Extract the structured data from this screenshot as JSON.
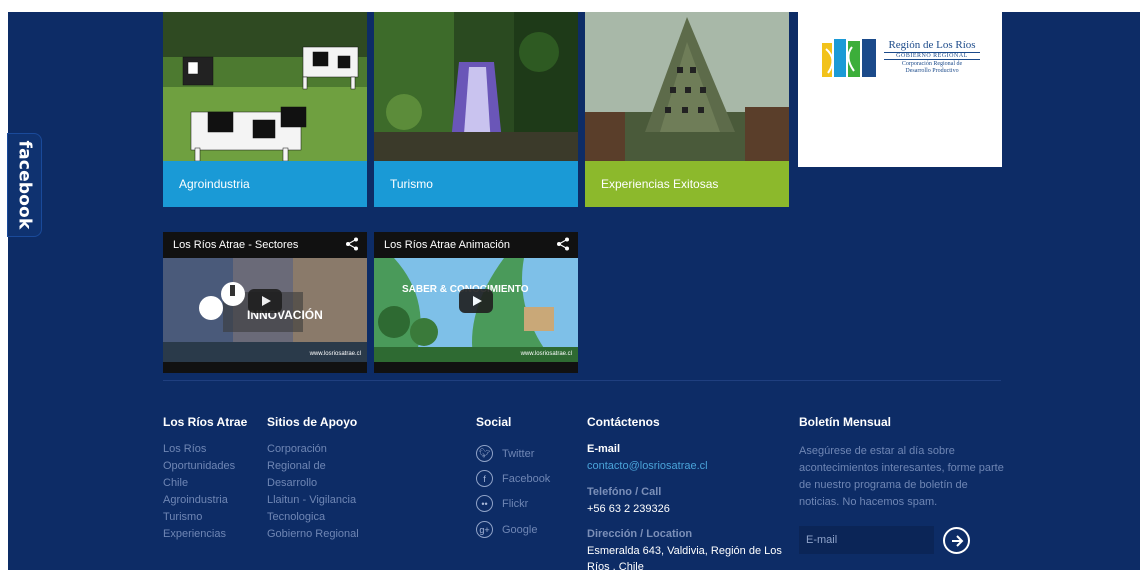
{
  "sidebar_tab": {
    "label": "facebook"
  },
  "tiles": [
    {
      "label": "Agroindustria",
      "color": "#1a9ad6"
    },
    {
      "label": "Turismo",
      "color": "#1a9ad6"
    },
    {
      "label": "Experiencias Exitosas",
      "color": "#8cb92c"
    }
  ],
  "logo": {
    "line1": "Región de Los Ríos",
    "line2": "GOBIERNO REGIONAL",
    "line3": "Corporación Regional de",
    "line4": "Desarrollo Productivo"
  },
  "videos": [
    {
      "title": "Los Ríos Atrae - Sectores",
      "overlay": "INNOVACIÓN",
      "url": "www.losriosatrae.cl"
    },
    {
      "title": "Los Ríos Atrae Animación",
      "overlay": "SABER & CONOCIMIENTO",
      "url": "www.losriosatrae.cl"
    }
  ],
  "footer": {
    "col1": {
      "heading": "Los Ríos Atrae",
      "items": [
        "Los Ríos",
        "Oportunidades",
        "Chile",
        "Agroindustria",
        "Turismo",
        "Experiencias"
      ]
    },
    "col2": {
      "heading": "Sitios de Apoyo",
      "items": [
        "Corporación",
        "Regional de",
        "Desarrollo",
        "Llaitun - Vigilancia",
        "Tecnologica",
        "Gobierno Regional"
      ]
    },
    "social": {
      "heading": "Social",
      "items": [
        "Twitter",
        "Facebook",
        "Flickr",
        "Google"
      ]
    },
    "contact": {
      "heading": "Contáctenos",
      "email_label": "E-mail",
      "email": "contacto@losriosatrae.cl",
      "phone_label": "Telefóno / Call",
      "phone": "+56 63 2 239326",
      "address_label": "Dirección / Location",
      "address_line1": "Esmeralda 643, Valdivia, Región de Los",
      "address_line2": "Ríos , Chile"
    },
    "newsletter": {
      "heading": "Boletín Mensual",
      "text": "Asegúrese de estar al día sobre acontecimientos interesantes, forme parte de nuestro programa de boletín de noticias. No hacemos spam.",
      "placeholder": "E-mail"
    }
  }
}
